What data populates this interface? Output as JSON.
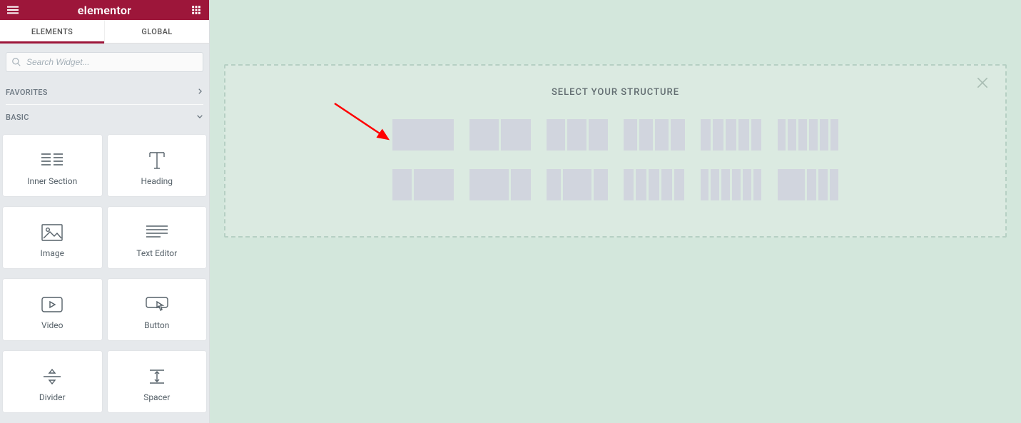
{
  "header": {
    "brand": "elementor"
  },
  "tabs": {
    "elements": "ELEMENTS",
    "global": "GLOBAL"
  },
  "search": {
    "placeholder": "Search Widget..."
  },
  "sections": {
    "favorites": "FAVORITES",
    "basic": "BASIC"
  },
  "widgets": {
    "inner_section": "Inner Section",
    "heading": "Heading",
    "image": "Image",
    "text_editor": "Text Editor",
    "video": "Video",
    "button": "Button",
    "divider": "Divider",
    "spacer": "Spacer"
  },
  "canvas": {
    "structure_title": "SELECT YOUR STRUCTURE"
  }
}
